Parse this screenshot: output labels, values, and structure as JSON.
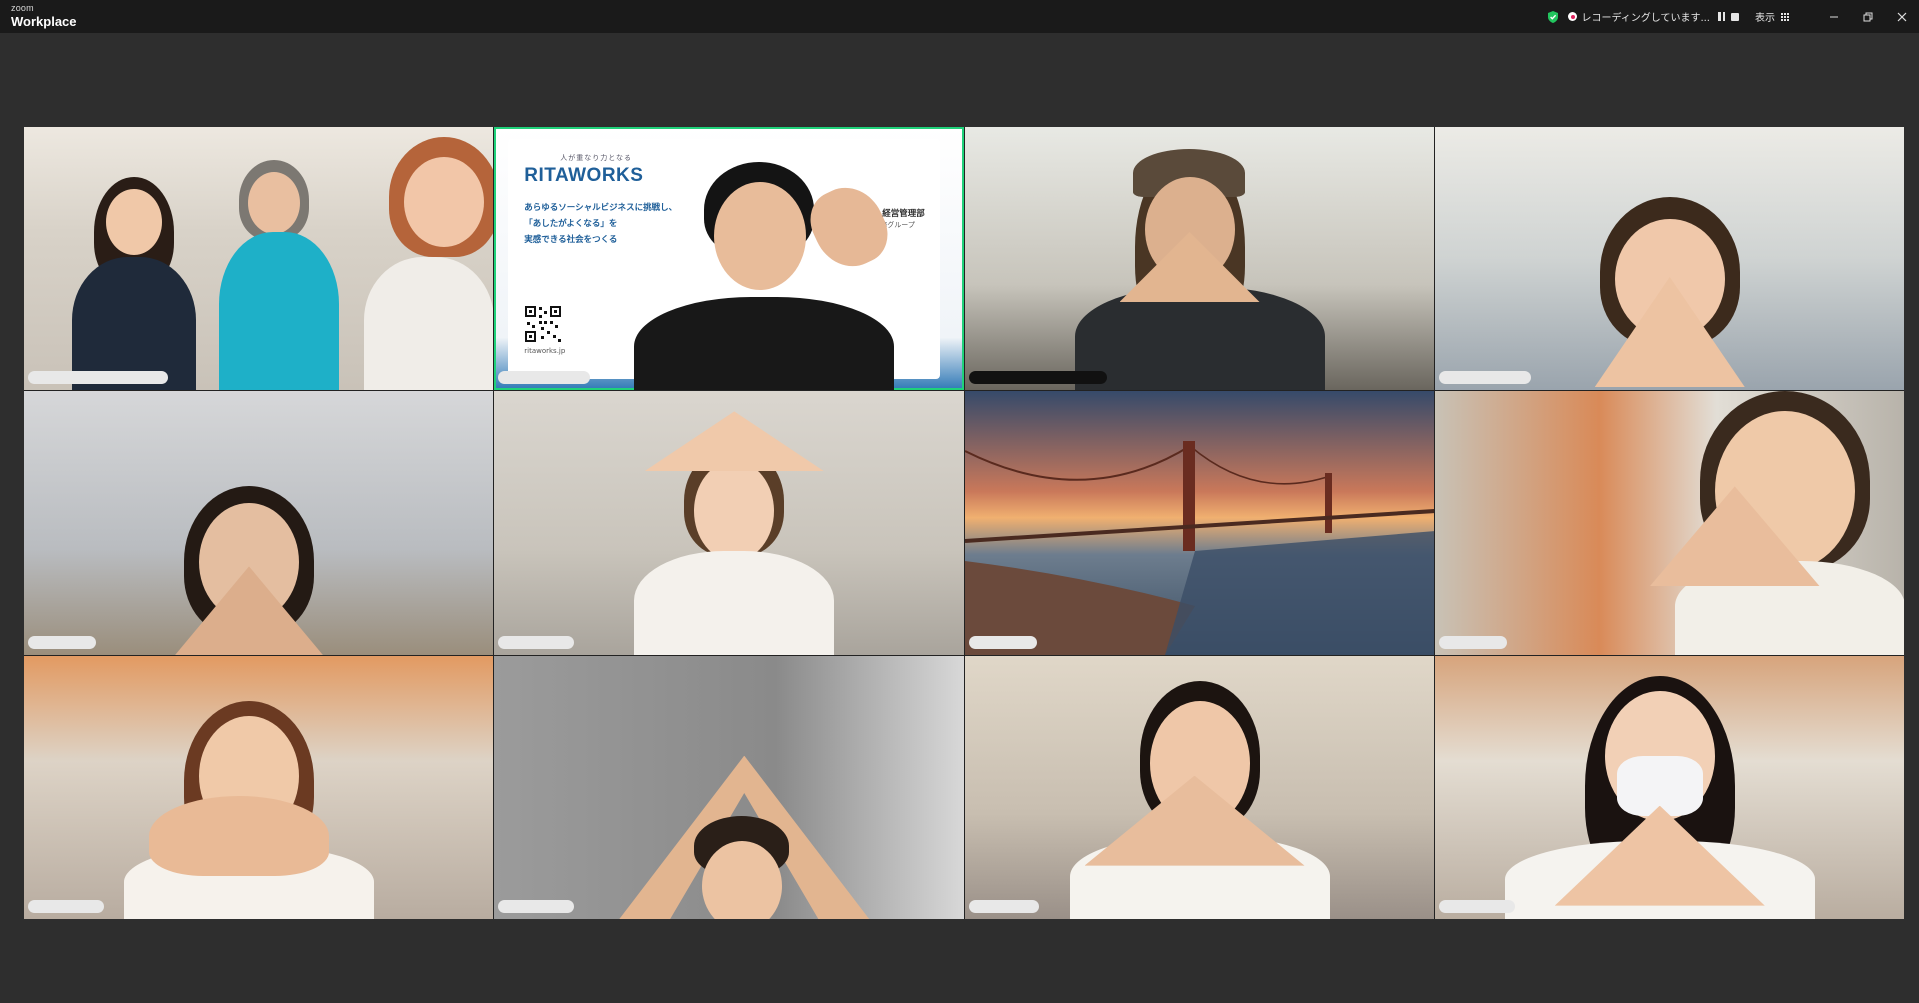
{
  "window": {
    "brand_small": "zoom",
    "brand_large": "Workplace",
    "recording_text": "レコーディングしています...",
    "view_label": "表示"
  },
  "slide": {
    "tagline": "人が重なり力となる",
    "logo": "RITAWORKS",
    "line1": "あらゆるソーシャルビジネスに挑戦し、",
    "line2": "「あしたがよくなる」を",
    "line3": "実感できる社会をつくる",
    "dept": "経営管理部",
    "group": "法務グループ",
    "url": "ritaworks.jp"
  },
  "gallery": {
    "tiles": [
      {
        "bg": "indoor-office-group",
        "active": false
      },
      {
        "bg": "ritaworks-slide",
        "active": true
      },
      {
        "bg": "indoor-office-cap",
        "active": false
      },
      {
        "bg": "indoor-office-window",
        "active": false
      },
      {
        "bg": "indoor-ceiling-lights",
        "active": false
      },
      {
        "bg": "blurred-indoor",
        "active": false
      },
      {
        "bg": "golden-gate-bridge-sunset",
        "active": false
      },
      {
        "bg": "blurred-indoor-orange",
        "active": false
      },
      {
        "bg": "blurred-indoor-orange",
        "active": false
      },
      {
        "bg": "grey-wall",
        "active": false
      },
      {
        "bg": "blurred-office",
        "active": false
      },
      {
        "bg": "blurred-office-orange",
        "active": false
      }
    ]
  },
  "colors": {
    "titlebar": "#1a1a1a",
    "background": "#2e2e2e",
    "active_speaker": "#1fd17a",
    "brand_blue": "#1f5f99",
    "recording": "#e0245e",
    "shield": "#22c55e"
  }
}
